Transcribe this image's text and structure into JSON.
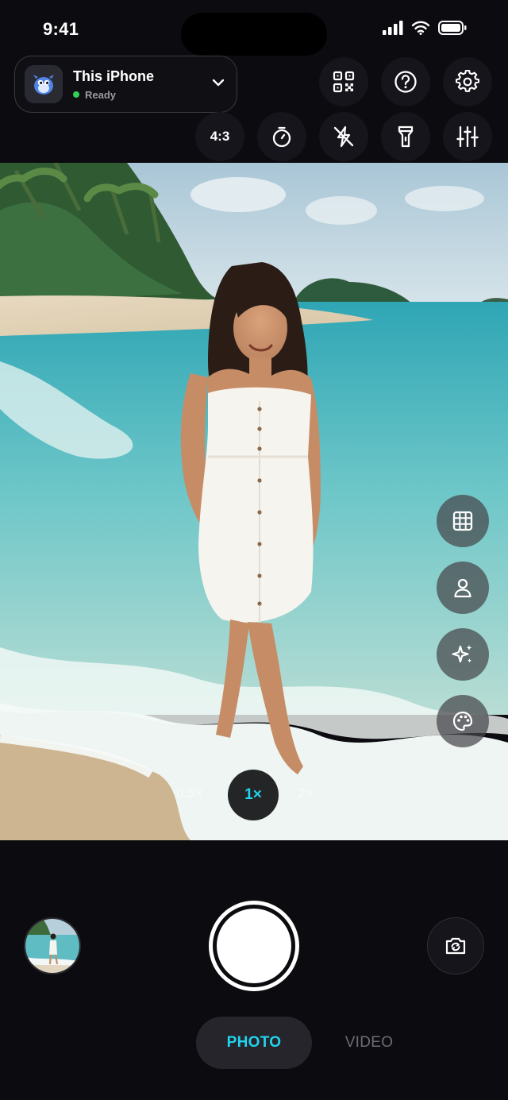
{
  "status_bar": {
    "time": "9:41"
  },
  "device": {
    "name": "This iPhone",
    "status": "Ready",
    "status_color": "#34d058",
    "icon": "mascot-avatar-icon"
  },
  "toolbar": {
    "aspect_ratio": "4:3",
    "icons": [
      "qr-code-icon",
      "help-icon",
      "settings-icon",
      "timer-icon",
      "flash-off-icon",
      "flashlight-icon",
      "adjustments-icon"
    ]
  },
  "side_controls": [
    "grid-icon",
    "person-icon",
    "sparkle-icon",
    "palette-icon"
  ],
  "zoom": {
    "options": [
      "0.5×",
      "1×",
      "2×"
    ],
    "selected": "1×"
  },
  "modes": {
    "photo": "PHOTO",
    "video": "VIDEO",
    "active": "PHOTO"
  },
  "colors": {
    "accent": "#22d3ee",
    "background": "#0b0b10",
    "button": "#15151b"
  }
}
